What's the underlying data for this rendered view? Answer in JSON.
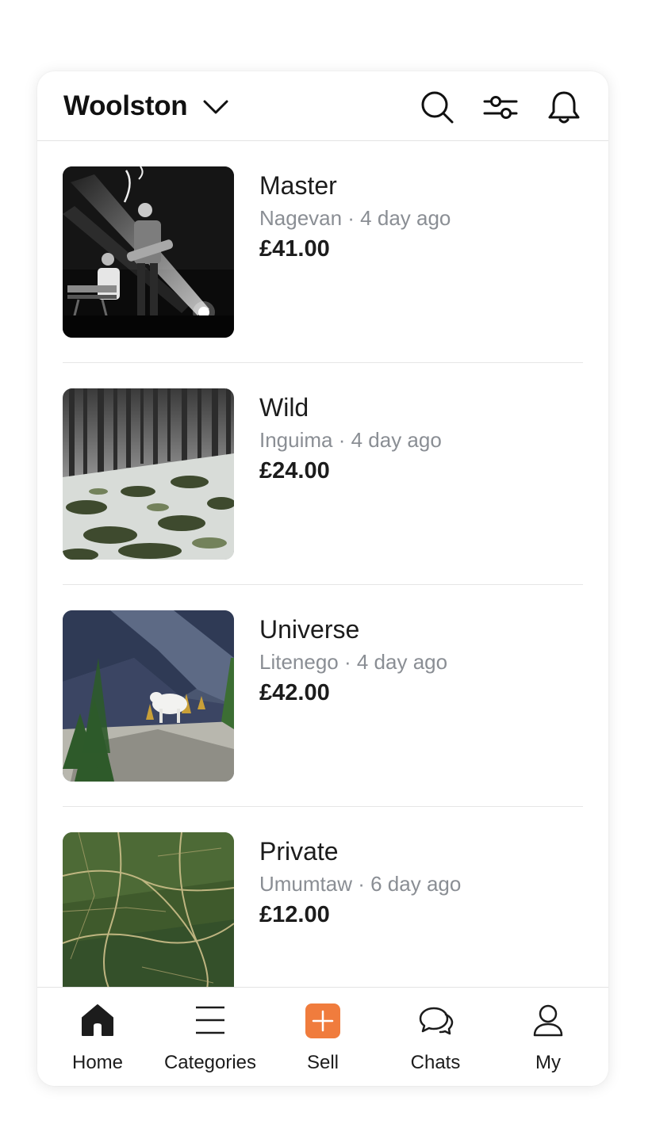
{
  "header": {
    "location": "Woolston",
    "icons": [
      "chevron-down-icon",
      "search-icon",
      "filter-sliders-icon",
      "bell-icon"
    ]
  },
  "listings": [
    {
      "title": "Master",
      "seller": "Nagevan",
      "age": "4 day ago",
      "price": "£41.00",
      "image": "concert-stage-photo"
    },
    {
      "title": "Wild",
      "seller": "Inguima",
      "age": "4 day ago",
      "price": "£24.00",
      "image": "snowy-forest-photo"
    },
    {
      "title": "Universe",
      "seller": "Litenego",
      "age": "4 day ago",
      "price": "£42.00",
      "image": "mountain-goat-photo"
    },
    {
      "title": "Private",
      "seller": "Umumtaw",
      "age": "6 day ago",
      "price": "£12.00",
      "image": "aerial-landscape-photo"
    }
  ],
  "listing_meta": [
    "Nagevan · 4 day ago",
    "Inguima · 4 day ago",
    "Litenego · 4 day ago",
    "Umumtaw · 6 day ago"
  ],
  "tabbar": {
    "tabs": [
      {
        "label": "Home",
        "icon": "home-icon",
        "active": true
      },
      {
        "label": "Categories",
        "icon": "menu-lines-icon",
        "active": false
      },
      {
        "label": "Sell",
        "icon": "plus-icon",
        "active": false
      },
      {
        "label": "Chats",
        "icon": "chat-bubbles-icon",
        "active": false
      },
      {
        "label": "My",
        "icon": "user-icon",
        "active": false
      }
    ]
  },
  "colors": {
    "accent": "#f07c3d",
    "text": "#1c1c1c",
    "meta": "#8a8e94",
    "divider": "#e6e6e6"
  }
}
